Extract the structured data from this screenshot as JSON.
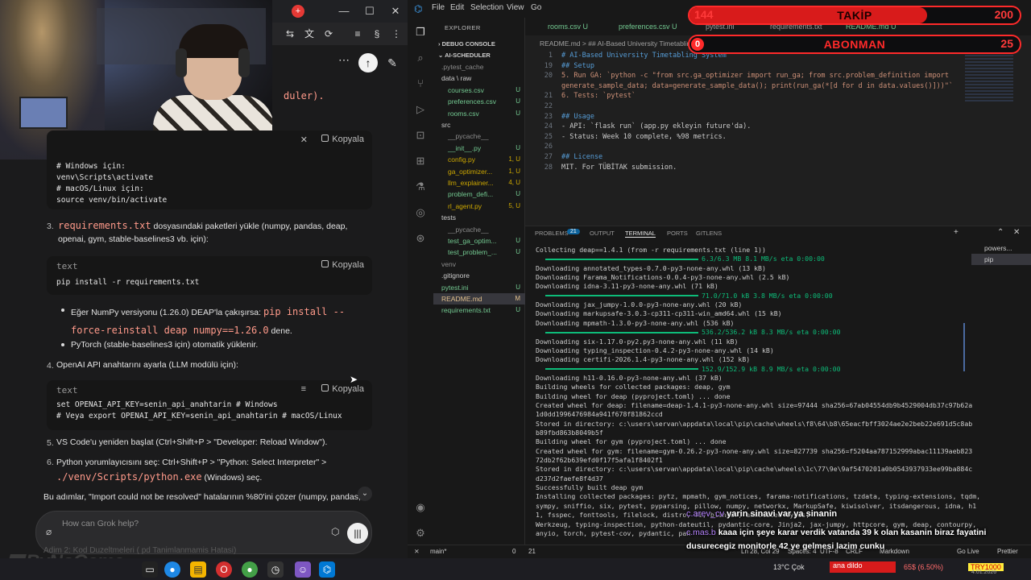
{
  "browser": {
    "window_buttons": [
      "—",
      "☐",
      "✕"
    ],
    "partial_code_text": "duler).",
    "codeblocks": [
      {
        "copy_label": "Kopyala",
        "lines": [
          "# Windows için:",
          "venv\\Scripts\\activate",
          "# macOS/Linux için:",
          "source venv/bin/activate"
        ]
      },
      {
        "lang": "text",
        "copy_label": "Kopyala",
        "lines": [
          "pip install -r requirements.txt"
        ]
      },
      {
        "lang": "text",
        "copy_label": "Kopyala",
        "lines": [
          "set OPENAI_API_KEY=senin_api_anahtarin  # Windows",
          "# Veya export OPENAI_API_KEY=senin_api_anahtarin  # macOS/Linux"
        ]
      }
    ],
    "steps": {
      "s3_num": "3.",
      "s3_code": "requirements.txt",
      "s3_text": " dosyasındaki paketleri yükle (numpy, pandas, deap,",
      "s3_text2": "openai, gym, stable-baselines3 vb. için):",
      "b1_text": "Eğer NumPy versiyonu (1.26.0) DEAP'la çakışırsa: ",
      "b1_code": "pip install --",
      "b1_code2": "force-reinstall deap numpy==1.26.0",
      "b1_tail": " dene.",
      "b2_text": "PyTorch (stable-baselines3 için) otomatik yüklenir.",
      "s4_num": "4.",
      "s4_text": "OpenAI API anahtarını ayarla (LLM modülü için):",
      "s5_num": "5.",
      "s5_text": "VS Code'u yeniden başlat (Ctrl+Shift+P > \"Developer: Reload Window\").",
      "s6_num": "6.",
      "s6_text": "Python yorumlayıcısını seç: Ctrl+Shift+P > \"Python: Select Interpreter\" >",
      "s6_code": "./venv/Scripts/python.exe",
      "s6_tail": " (Windows) seç.",
      "summary": "Bu adımlar, \"Import could not be resolved\" hatalarının %80'ini çözer (numpy, pandas,"
    },
    "ask_placeholder": "How can Grok help?",
    "bottom_partial": "Adim 2: Kod Duzeltmeleri ( pd  Tanimlanmamis Hatasi)",
    "logo_text": "ByNoGame"
  },
  "vscode": {
    "menu": [
      "File",
      "Edit",
      "Selection",
      "View",
      "Go"
    ],
    "explorer_label": "EXPLORER",
    "debug_console": "DEBUG CONSOLE",
    "project": "AI-SCHEDULER",
    "tree": [
      {
        "label": ".pytest_cache",
        "status": "",
        "indent": 1,
        "color": "#8b8b8b"
      },
      {
        "label": "data \\ raw",
        "status": "",
        "indent": 1,
        "color": "#cccccc"
      },
      {
        "label": "courses.csv",
        "status": "U",
        "indent": 2,
        "color": "#73c991"
      },
      {
        "label": "preferences.csv",
        "status": "U",
        "indent": 2,
        "color": "#73c991"
      },
      {
        "label": "rooms.csv",
        "status": "U",
        "indent": 2,
        "color": "#73c991"
      },
      {
        "label": "src",
        "status": "",
        "indent": 1,
        "color": "#cccccc"
      },
      {
        "label": "__pycache__",
        "status": "",
        "indent": 2,
        "color": "#8b8b8b"
      },
      {
        "label": "__init__.py",
        "status": "U",
        "indent": 2,
        "color": "#73c991"
      },
      {
        "label": "config.py",
        "status": "1, U",
        "indent": 2,
        "color": "#cca700"
      },
      {
        "label": "ga_optimizer...",
        "status": "1, U",
        "indent": 2,
        "color": "#cca700"
      },
      {
        "label": "llm_explainer...",
        "status": "4, U",
        "indent": 2,
        "color": "#cca700"
      },
      {
        "label": "problem_defi...",
        "status": "U",
        "indent": 2,
        "color": "#73c991"
      },
      {
        "label": "rl_agent.py",
        "status": "5, U",
        "indent": 2,
        "color": "#cca700"
      },
      {
        "label": "tests",
        "status": "",
        "indent": 1,
        "color": "#cccccc"
      },
      {
        "label": "__pycache__",
        "status": "",
        "indent": 2,
        "color": "#8b8b8b"
      },
      {
        "label": "test_ga_optim...",
        "status": "U",
        "indent": 2,
        "color": "#73c991"
      },
      {
        "label": "test_problem_...",
        "status": "U",
        "indent": 2,
        "color": "#73c991"
      },
      {
        "label": "venv",
        "status": "",
        "indent": 1,
        "color": "#8b8b8b"
      },
      {
        "label": ".gitignore",
        "status": "",
        "indent": 1,
        "color": "#cccccc"
      },
      {
        "label": "pytest.ini",
        "status": "U",
        "indent": 1,
        "color": "#73c991"
      },
      {
        "label": "README.md",
        "status": "M",
        "indent": 1,
        "color": "#e2c08d"
      },
      {
        "label": "requirements.txt",
        "status": "U",
        "indent": 1,
        "color": "#73c991"
      }
    ],
    "tabs": [
      {
        "label": "rooms.csv",
        "status": "U"
      },
      {
        "label": "preferences.csv",
        "status": "U"
      },
      {
        "label": "pytest.ini",
        "status": ""
      },
      {
        "label": "requirements.txt",
        "status": ""
      },
      {
        "label": "README.md",
        "status": "U"
      }
    ],
    "breadcrumb": "README.md > ## AI-Based University Timetabling System > ## License",
    "code": [
      {
        "ln": "1",
        "text": "# AI-Based University Timetabling System",
        "color": "#569cd6"
      },
      {
        "ln": "19",
        "text": "## Setup",
        "color": "#569cd6"
      },
      {
        "ln": "20",
        "text": "5. Run GA: `python -c \"from src.ga_optimizer import run_ga; from src.problem_definition import",
        "color": "#ce9178"
      },
      {
        "ln": "",
        "text": "generate_sample_data; data=generate_sample_data(); print(run_ga(*[d for d in data.values()]))\"`",
        "color": "#ce9178"
      },
      {
        "ln": "21",
        "text": "6. Tests: `pytest`",
        "color": "#ce9178"
      },
      {
        "ln": "22",
        "text": "",
        "color": "#cccccc"
      },
      {
        "ln": "23",
        "text": "## Usage",
        "color": "#569cd6"
      },
      {
        "ln": "24",
        "text": "- API: `flask run` (app.py ekleyin future'da).",
        "color": "#cccccc"
      },
      {
        "ln": "25",
        "text": "- Status: Week 10 complete, %98 metrics.",
        "color": "#cccccc"
      },
      {
        "ln": "26",
        "text": "",
        "color": "#cccccc"
      },
      {
        "ln": "27",
        "text": "## License",
        "color": "#569cd6"
      },
      {
        "ln": "28",
        "text": "MIT. For TÜBİTAK submission.",
        "color": "#cccccc"
      }
    ],
    "panel_tabs": [
      "PROBLEMS",
      "OUTPUT",
      "TERMINAL",
      "PORTS",
      "GITLENS"
    ],
    "problems_count": "21",
    "terminal_lines": [
      {
        "t": "Collecting deap==1.4.1 (from -r requirements.txt (line 1))",
        "bar": ""
      },
      {
        "t": "",
        "bar": "6.3/6.3 MB 8.1 MB/s eta 0:00:00"
      },
      {
        "t": "Downloading annotated_types-0.7.0-py3-none-any.whl (13 kB)",
        "bar": ""
      },
      {
        "t": "Downloading Farama_Notifications-0.0.4-py3-none-any.whl (2.5 kB)",
        "bar": ""
      },
      {
        "t": "Downloading idna-3.11-py3-none-any.whl (71 kB)",
        "bar": ""
      },
      {
        "t": "",
        "bar": "71.0/71.0 kB 3.8 MB/s eta 0:00:00"
      },
      {
        "t": "Downloading jax_jumpy-1.0.0-py3-none-any.whl (20 kB)",
        "bar": ""
      },
      {
        "t": "Downloading markupsafe-3.0.3-cp311-cp311-win_amd64.whl (15 kB)",
        "bar": ""
      },
      {
        "t": "Downloading mpmath-1.3.0-py3-none-any.whl (536 kB)",
        "bar": ""
      },
      {
        "t": "",
        "bar": "536.2/536.2 kB 8.3 MB/s eta 0:00:00"
      },
      {
        "t": "Downloading six-1.17.0-py2.py3-none-any.whl (11 kB)",
        "bar": ""
      },
      {
        "t": "Downloading typing_inspection-0.4.2-py3-none-any.whl (14 kB)",
        "bar": ""
      },
      {
        "t": "Downloading certifi-2026.1.4-py3-none-any.whl (152 kB)",
        "bar": ""
      },
      {
        "t": "",
        "bar": "152.9/152.9 kB 8.9 MB/s eta 0:00:00"
      },
      {
        "t": "Downloading h11-0.16.0-py3-none-any.whl (37 kB)",
        "bar": ""
      },
      {
        "t": "Building wheels for collected packages: deap, gym",
        "bar": ""
      },
      {
        "t": "  Building wheel for deap (pyproject.toml) ... done",
        "bar": ""
      },
      {
        "t": "  Created wheel for deap: filename=deap-1.4.1-py3-none-any.whl size=97444 sha256=67ab04554db9b4529004db37c97b62a",
        "bar": ""
      },
      {
        "t": "1d0dd1996476984a941f678f81862ccd",
        "bar": ""
      },
      {
        "t": "  Stored in directory: c:\\users\\servan\\appdata\\local\\pip\\cache\\wheels\\f8\\64\\b8\\65eacfbff3024ae2e2beb22e691d5c8ab",
        "bar": ""
      },
      {
        "t": "b89fbd863b8049b5f",
        "bar": ""
      },
      {
        "t": "  Building wheel for gym (pyproject.toml) ... done",
        "bar": ""
      },
      {
        "t": "  Created wheel for gym: filename=gym-0.26.2-py3-none-any.whl size=827739 sha256=f5204aa787152999abac11139aeb823",
        "bar": ""
      },
      {
        "t": "72db2f62b639efd0f17f5afa1f8402f1",
        "bar": ""
      },
      {
        "t": "  Stored in directory: c:\\users\\servan\\appdata\\local\\pip\\cache\\wheels\\1c\\77\\9e\\9af5470201a0b0543937933ee99ba884c",
        "bar": ""
      },
      {
        "t": "d237d2faefe8f4d37",
        "bar": ""
      },
      {
        "t": "Successfully built deap gym",
        "bar": ""
      },
      {
        "t": "Installing collected packages: pytz, mpmath, gym_notices, farama-notifications, tzdata, typing-extensions, tqdm,",
        "bar": ""
      },
      {
        "t": " sympy, sniffio, six, pytest, pyparsing, pillow, numpy, networkx, MarkupSafe, kiwisolver, itsdangerous, idna, h1",
        "bar": ""
      },
      {
        "t": "1, fsspec, fonttools, filelock, distro,                                              fi, blinker, annotated-types,",
        "bar": ""
      },
      {
        "t": " Werkzeug, typing-inspection, python-dateutil, pydantic-core, Jinja2, jax-jumpy, httpcore, gym, deap, contourpy,",
        "bar": ""
      },
      {
        "t": "anyio, torch, pytest-cov, pydantic, pan",
        "bar": ""
      }
    ],
    "terminal_list": [
      "powers...",
      "pip"
    ],
    "status": {
      "branch": "main*",
      "errors": "0",
      "warnings": "21",
      "pos": "Ln 28, Col 29",
      "spaces": "Spaces: 4",
      "enc": "UTF-8",
      "eol": "CRLF",
      "lang": "Markdown",
      "golive": "Go Live",
      "prettier": "Prettier"
    }
  },
  "overlay": {
    "follow": {
      "left": "144",
      "label": "TAKİP",
      "right": "200",
      "progress": 0.72
    },
    "subs": {
      "left": "0",
      "label": "ABONMAN",
      "right": "25",
      "progress": 0.0
    },
    "chat1_user": "c.arev_cv",
    "chat1_text": "yarin sinavi var ya sinanin",
    "chat2_user": "c.mas.b",
    "chat2_text": "kaaa için şeye karar verdik vatanda 39 k olan kasanin biraz fayatini",
    "chat2_text2": "dusurecegiz monitorle 42 ye gelmesi lazim cunku"
  },
  "taskbar": {
    "weather": "13°C  Çok",
    "ticker": "ana dildo",
    "ticker2": "65$ (6.50%)",
    "ticker3": "TRY1000",
    "date": "4.01.2026"
  }
}
